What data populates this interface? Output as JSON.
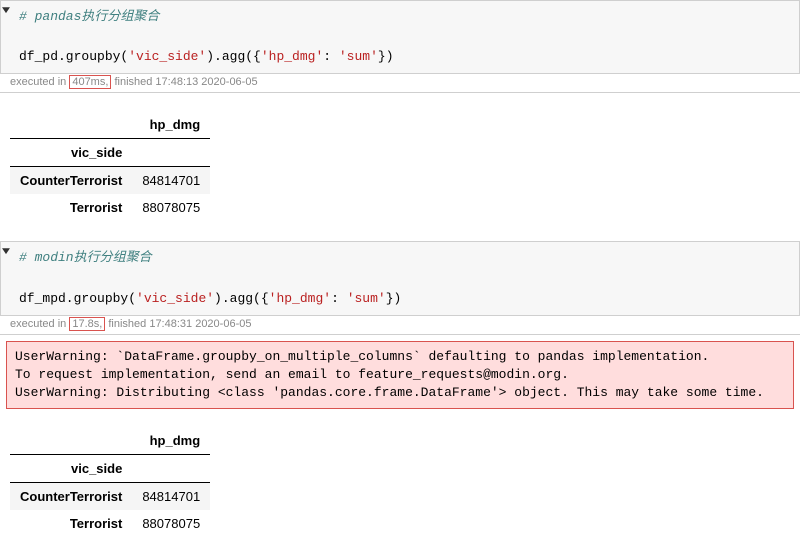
{
  "cell1": {
    "comment": "# pandas执行分组聚合",
    "code_prefix": "df_pd.groupby(",
    "code_arg1": "'vic_side'",
    "code_mid": ").agg({",
    "code_key": "'hp_dmg'",
    "code_colon": ": ",
    "code_val": "'sum'",
    "code_suffix": "})",
    "exec_prefix": "executed in ",
    "exec_time": "407ms,",
    "exec_suffix": " finished 17:48:13 2020-06-05"
  },
  "table1": {
    "col_header": "hp_dmg",
    "index_name": "vic_side",
    "rows": [
      {
        "idx": "CounterTerrorist",
        "val": "84814701"
      },
      {
        "idx": "Terrorist",
        "val": "88078075"
      }
    ]
  },
  "cell2": {
    "comment": "# modin执行分组聚合",
    "code_prefix": "df_mpd.groupby(",
    "code_arg1": "'vic_side'",
    "code_mid": ").agg({",
    "code_key": "'hp_dmg'",
    "code_colon": ": ",
    "code_val": "'sum'",
    "code_suffix": "})",
    "exec_prefix": "executed in ",
    "exec_time": "17.8s,",
    "exec_suffix": " finished 17:48:31 2020-06-05"
  },
  "warning": {
    "line1": "UserWarning: `DataFrame.groupby_on_multiple_columns` defaulting to pandas implementation.",
    "line2": "To request implementation, send an email to feature_requests@modin.org.",
    "line3": "UserWarning: Distributing <class 'pandas.core.frame.DataFrame'> object. This may take some time."
  },
  "table2": {
    "col_header": "hp_dmg",
    "index_name": "vic_side",
    "rows": [
      {
        "idx": "CounterTerrorist",
        "val": "84814701"
      },
      {
        "idx": "Terrorist",
        "val": "88078075"
      }
    ]
  }
}
